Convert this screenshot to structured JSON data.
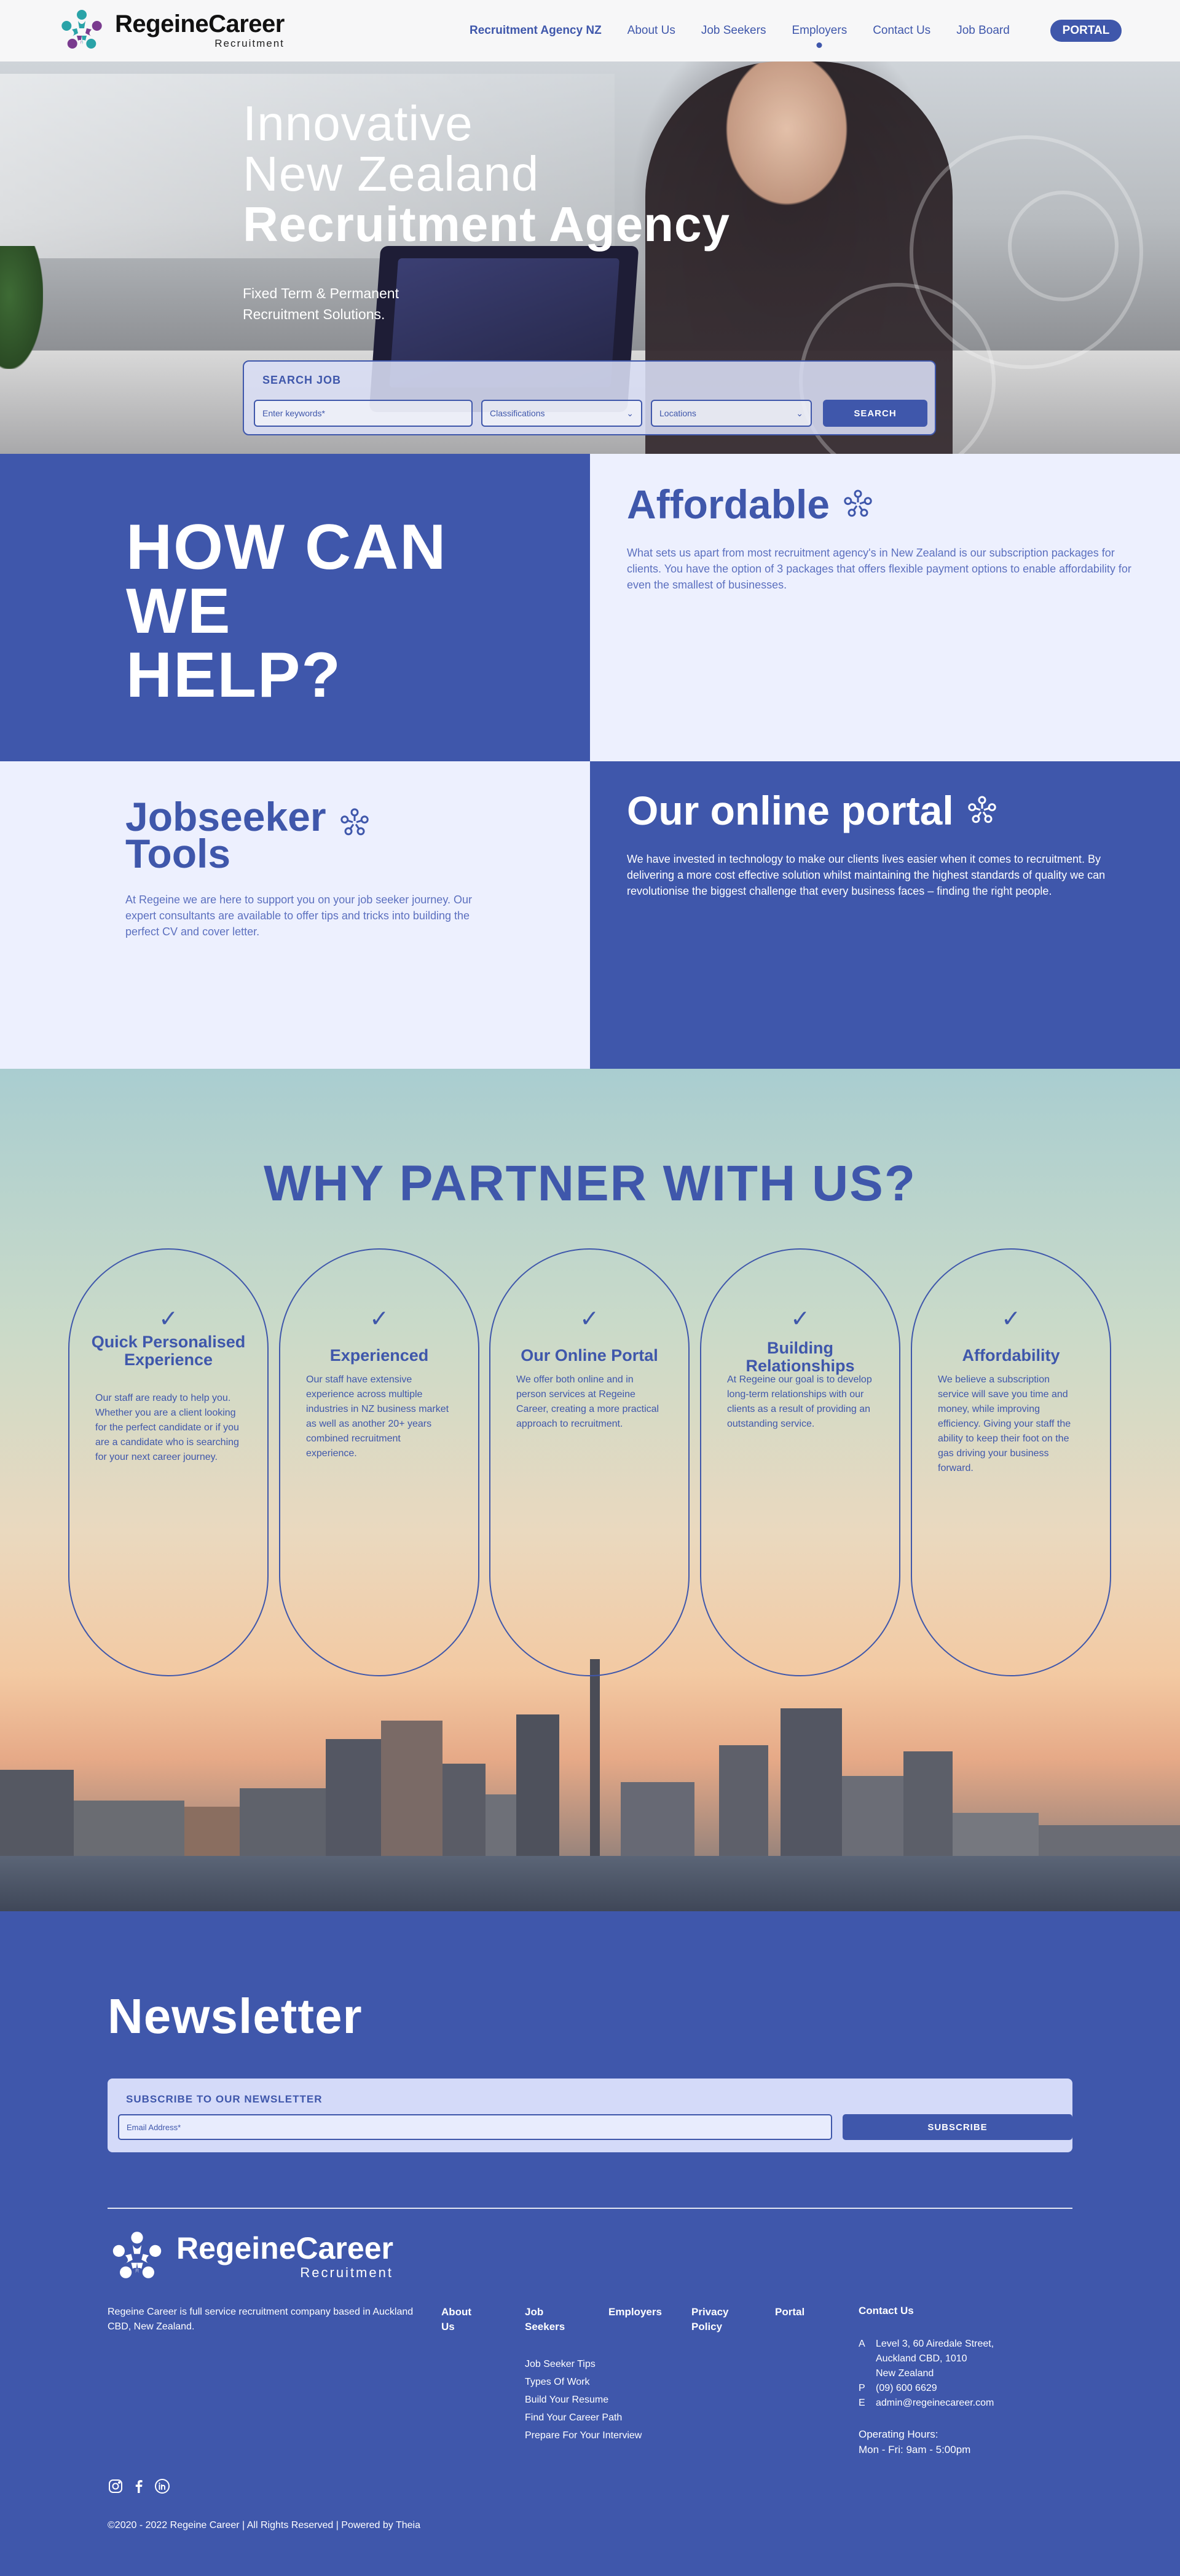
{
  "header": {
    "logo_name": "RegeineCareer",
    "logo_sub": "Recruitment",
    "nav": [
      {
        "label": "Recruitment Agency NZ"
      },
      {
        "label": "About Us"
      },
      {
        "label": "Job Seekers"
      },
      {
        "label": "Employers"
      },
      {
        "label": "Contact Us"
      },
      {
        "label": "Job Board"
      }
    ],
    "portal_label": "PORTAL"
  },
  "hero": {
    "title_line1": "Innovative",
    "title_line2": "New Zealand",
    "title_line3": "Recruitment Agency",
    "subtitle_line1": "Fixed Term & Permanent",
    "subtitle_line2": "Recruitment Solutions.",
    "search": {
      "label": "SEARCH JOB",
      "keywords_placeholder": "Enter keywords*",
      "classifications_placeholder": "Classifications",
      "locations_placeholder": "Locations",
      "button_label": "SEARCH"
    }
  },
  "help": {
    "title_line1": "HOW CAN",
    "title_line2": "WE",
    "title_line3": "HELP?",
    "affordable": {
      "title": "Affordable",
      "text": "What sets us apart from most recruitment agency's in New Zealand is our subscription packages for clients. You have the option of 3 packages that offers flexible payment options to enable affordability for even the smallest of businesses."
    },
    "jobseeker": {
      "title_line1": "Jobseeker",
      "title_line2": "Tools",
      "text": "At Regeine we are here to support you on your job seeker journey. Our expert consultants are available to offer tips and tricks into building the perfect CV and cover letter."
    },
    "portal": {
      "title": "Our online portal",
      "text": "We have invested in technology to make our clients lives easier when it comes to recruitment. By delivering a more cost effective solution whilst maintaining the highest standards of quality we can revolutionise the biggest challenge that every business faces – finding the right people."
    }
  },
  "why": {
    "title": "WHY PARTNER WITH US?",
    "check": "✓",
    "cards": [
      {
        "title": "Quick Personalised Experience",
        "text": "Our staff are ready to help you. Whether you are a client looking for the perfect candidate or if you are a candidate who is searching for your next career journey."
      },
      {
        "title": "Experienced",
        "text": "Our staff have extensive experience across multiple industries in NZ business market as well as another 20+ years combined recruitment experience."
      },
      {
        "title": "Our Online Portal",
        "text": "We offer both online and in person services at Regeine Career, creating a more practical approach to recruitment."
      },
      {
        "title": "Building Relationships",
        "text": "At Regeine our goal is to develop long-term relationships with our clients as a result of providing an outstanding service."
      },
      {
        "title": "Affordability",
        "text": "We believe a subscription service will save you time and money, while improving efficiency. Giving your staff the ability to keep their foot on the gas driving your business forward."
      }
    ]
  },
  "newsletter": {
    "title": "Newsletter",
    "label": "SUBSCRIBE TO OUR NEWSLETTER",
    "email_placeholder": "Email Address*",
    "button_label": "SUBSCRIBE"
  },
  "footer": {
    "logo_name": "RegeineCareer",
    "logo_sub": "Recruitment",
    "about": "Regeine Career is full service recruitment company based in Auckland CBD, New Zealand.",
    "col_about": "About Us",
    "col_jobseekers": "Job Seekers",
    "col_employers": "Employers",
    "col_privacy": "Privacy Policy",
    "col_portal": "Portal",
    "jobseeker_links": [
      "Job Seeker Tips",
      "Types Of Work",
      "Build Your Resume",
      "Find Your Career Path",
      "Prepare For Your Interview"
    ],
    "contact_heading": "Contact Us",
    "address_key": "A",
    "address_lines": [
      "Level 3, 60 Airedale Street,",
      "Auckland CBD, 1010",
      "New Zealand"
    ],
    "phone_key": "P",
    "phone": "(09) 600 6629",
    "email_key": "E",
    "email": "admin@regeinecareer.com",
    "hours_label": "Operating Hours:",
    "hours": "Mon - Fri: 9am - 5:00pm",
    "copyright": "©2020 - 2022 Regeine Career | All Rights Reserved | Powered by Theia"
  },
  "colors": {
    "brand_blue": "#3f57ab",
    "pale_blue": "#edf0fe",
    "logo_teal": "#2aa3a8",
    "logo_purple": "#7a3b8f"
  }
}
